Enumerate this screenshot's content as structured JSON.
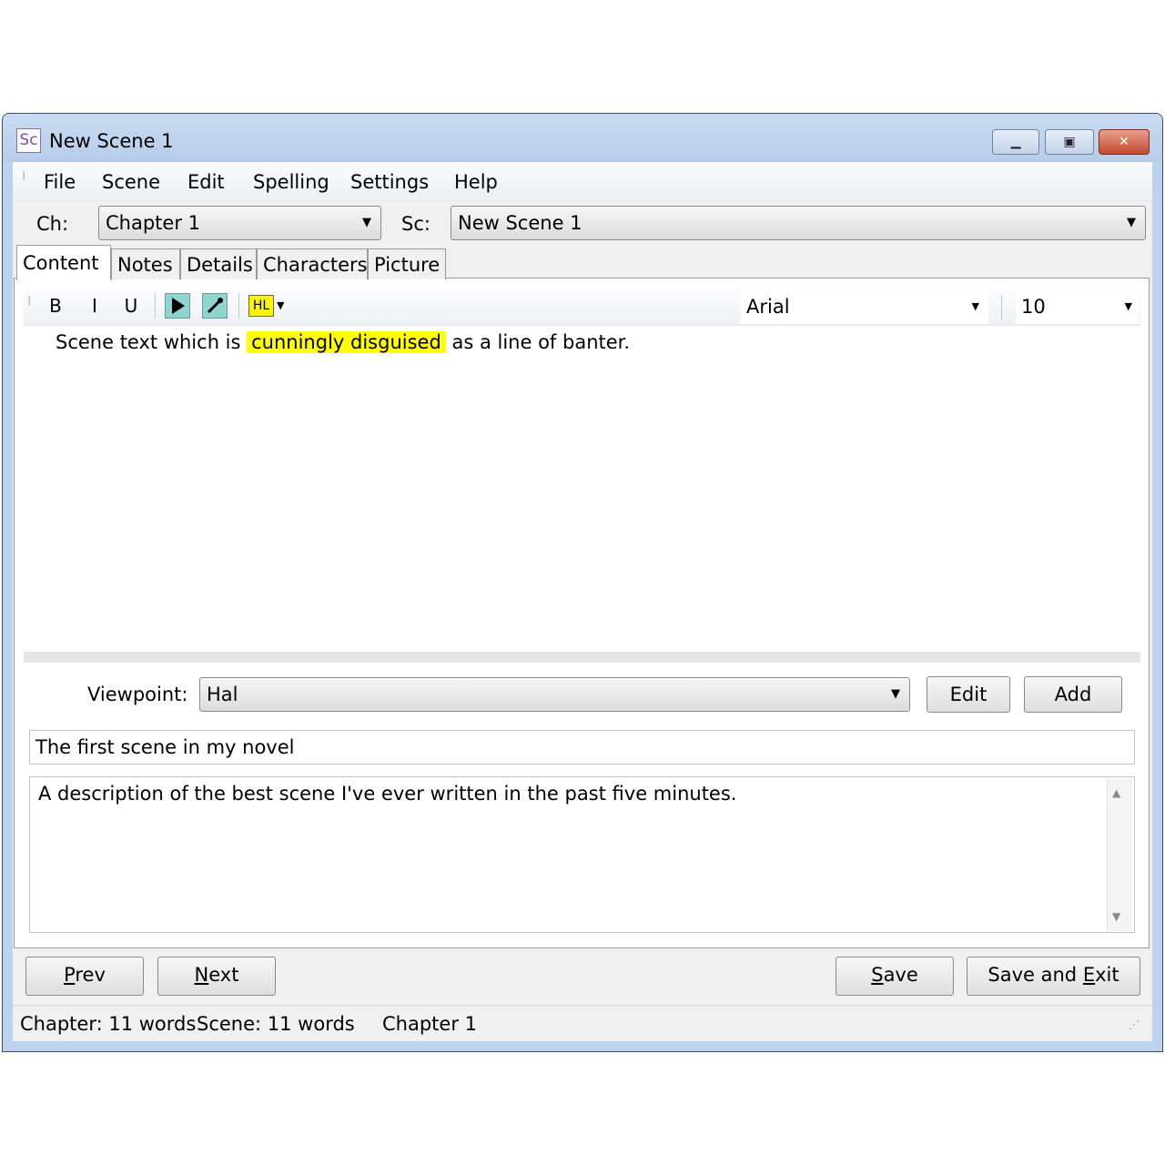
{
  "window": {
    "title": "New Scene 1",
    "app_icon": "Sc",
    "controls": {
      "minimize": "minimize-icon",
      "maximize": "maximize-icon",
      "close": "close-icon"
    }
  },
  "menu": [
    "File",
    "Scene",
    "Edit",
    "Spelling",
    "Settings",
    "Help"
  ],
  "selectors": {
    "chapter_label": "Ch:",
    "chapter_value": "Chapter 1",
    "scene_label": "Sc:",
    "scene_value": "New Scene 1"
  },
  "tabs": [
    "Content",
    "Notes",
    "Details",
    "Characters",
    "Picture"
  ],
  "active_tab": "Content",
  "toolbar": {
    "bold": "B",
    "italic": "I",
    "underline": "U",
    "play_icon": "play-icon",
    "wrench_icon": "wrench-icon",
    "highlight": "HL",
    "font": "Arial",
    "size": "10"
  },
  "scene_text": {
    "before": "Scene text which is ",
    "highlighted": "cunningly disguised",
    "after": " as a line of banter."
  },
  "viewpoint": {
    "label": "Viewpoint:",
    "value": "Hal",
    "edit_label": "Edit",
    "add_label": "Add"
  },
  "summary": "The first scene in my novel",
  "description": "A description of the best scene I've ever written in the past five minutes.",
  "buttons": {
    "prev_hotkey": "P",
    "prev_rest": "rev",
    "next_hotkey": "N",
    "next_rest": "ext",
    "save_hotkey": "S",
    "save_rest": "ave",
    "saveexit_before": "Save and ",
    "saveexit_hotkey": "E",
    "saveexit_after": "xit"
  },
  "status": {
    "chapter_words": "Chapter: 11 words",
    "scene_words": "Scene: 11 words",
    "chapter_name": "Chapter 1"
  },
  "colors": {
    "highlight": "#ffff00",
    "tool_button": "#8fd5cf",
    "close_button": "#c4492f"
  }
}
